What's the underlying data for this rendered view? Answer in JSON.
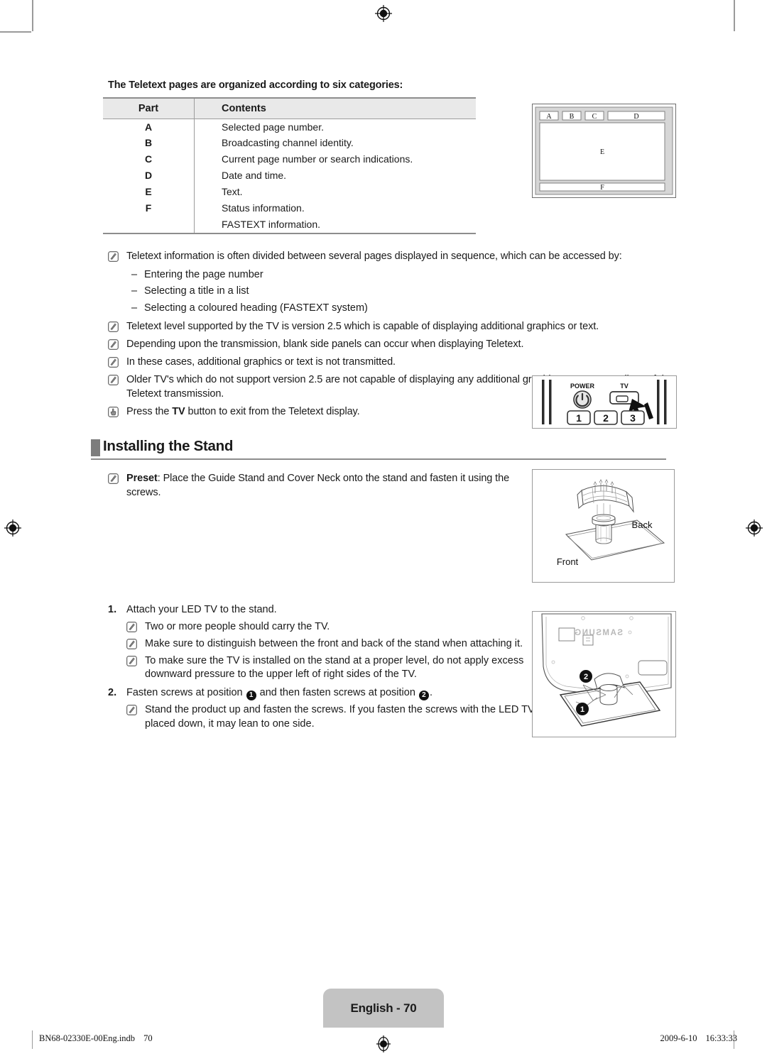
{
  "intro": "The Teletext pages are organized according to six categories:",
  "table": {
    "headers": [
      "Part",
      "Contents"
    ],
    "rows": [
      {
        "part": "A",
        "contents": "Selected page number."
      },
      {
        "part": "B",
        "contents": "Broadcasting channel identity."
      },
      {
        "part": "C",
        "contents": "Current page number or search indications."
      },
      {
        "part": "D",
        "contents": "Date and time."
      },
      {
        "part": "E",
        "contents": "Text."
      },
      {
        "part": "F",
        "contents": "Status information."
      },
      {
        "part": "",
        "contents": "FASTEXT information."
      }
    ]
  },
  "screen_figure": {
    "top_labels": [
      "A",
      "B",
      "C",
      "D"
    ],
    "center_label": "E",
    "bottom_label": "F"
  },
  "notes": [
    {
      "icon": "note-pencil-icon",
      "text": "Teletext information is often divided between several pages displayed in sequence, which can be accessed by:"
    },
    {
      "icon": "note-pencil-icon",
      "text": "Teletext level supported by the TV is version 2.5 which is capable of displaying additional graphics or text."
    },
    {
      "icon": "note-pencil-icon",
      "text": "Depending upon the transmission, blank side panels can occur when displaying Teletext."
    },
    {
      "icon": "note-pencil-icon",
      "text": "In these cases, additional graphics or text is not transmitted."
    },
    {
      "icon": "note-pencil-icon",
      "text": "Older TV's which do not support version 2.5 are not capable of displaying any additional graphics or text, regardless of the Teletext transmission."
    }
  ],
  "sub_dashes": [
    "Entering the page number",
    "Selecting a title in a list",
    "Selecting a coloured heading (FASTEXT system)"
  ],
  "press_note": {
    "icon": "hand-press-icon",
    "prefix": "Press the ",
    "bold": "TV",
    "suffix": " button to exit from the Teletext display."
  },
  "remote_figure": {
    "power_label": "POWER",
    "tv_label": "TV",
    "keys": [
      "1",
      "2",
      "3"
    ]
  },
  "section": {
    "title": "Installing the Stand",
    "preset": {
      "icon": "note-pencil-icon",
      "bold": "Preset",
      "text": ": Place the Guide Stand and Cover Neck onto the stand and fasten it using the screws."
    }
  },
  "stand_figure": {
    "back_label": "Back",
    "front_label": "Front"
  },
  "tv_back_figure": {
    "brand": "SAMSUNG",
    "markers": [
      "1",
      "2"
    ]
  },
  "steps": [
    {
      "number": "1.",
      "text": "Attach your LED TV to the stand.",
      "subs": [
        "Two or more people should carry the TV.",
        "Make sure to distinguish between the front and back of the stand when attaching it.",
        "To make sure the TV is installed on the stand at a proper level, do not apply excess downward pressure to the upper left of right sides of the TV."
      ]
    },
    {
      "number": "2.",
      "text_part1": "Fasten screws at position ",
      "marker1": "1",
      "text_part2": " and then fasten screws at position ",
      "marker2": "2",
      "text_part3": ".",
      "subs": [
        "Stand the product up and fasten the screws. If you fasten the screws with the LED TV placed down, it may lean to one side."
      ]
    }
  ],
  "page_tab": "English - 70",
  "footer": {
    "file": "BN68-02330E-00Eng.indb",
    "page": "70",
    "date": "2009-6-10",
    "time": "16:33:33"
  }
}
